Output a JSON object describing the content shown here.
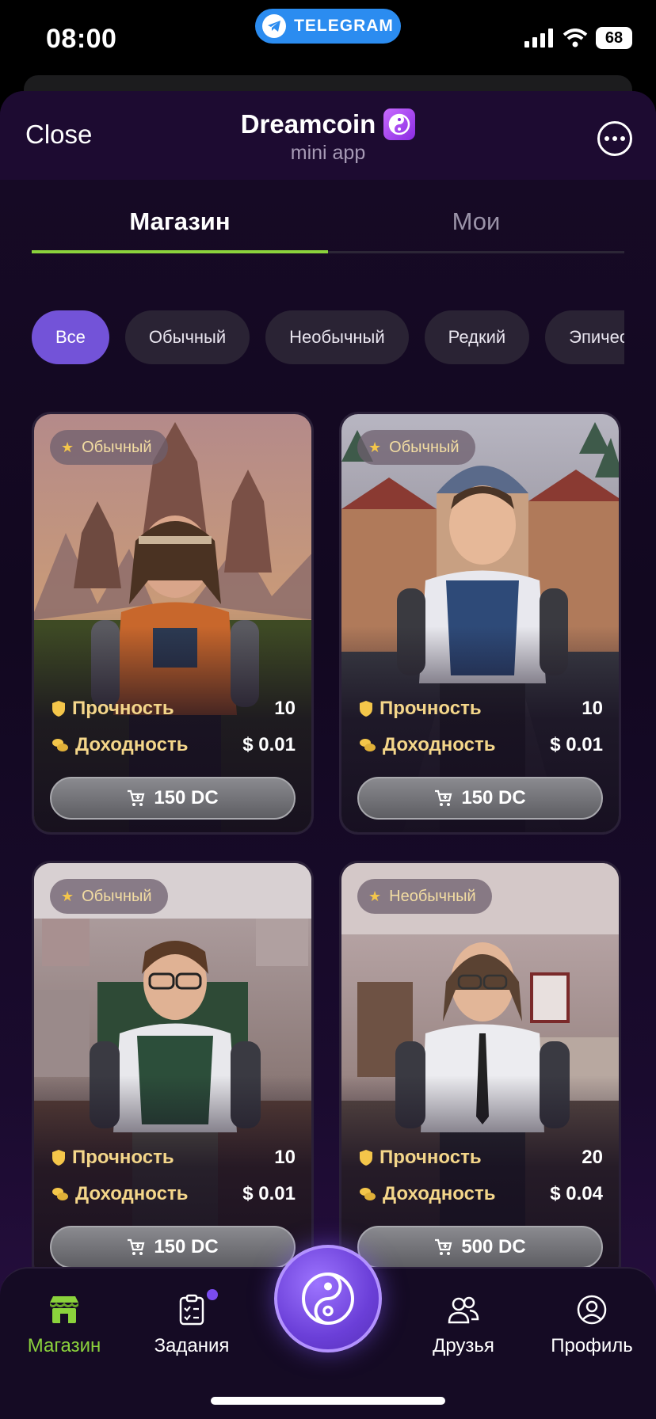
{
  "status_bar": {
    "time": "08:00",
    "telegram_label": "TELEGRAM",
    "battery": "68"
  },
  "header": {
    "close_label": "Close",
    "title": "Dreamcoin",
    "subtitle": "mini app"
  },
  "tabs": [
    {
      "label": "Магазин"
    },
    {
      "label": "Мои"
    }
  ],
  "filters": [
    {
      "label": "Все"
    },
    {
      "label": "Обычный"
    },
    {
      "label": "Необычный"
    },
    {
      "label": "Редкий"
    },
    {
      "label": "Эпичес"
    }
  ],
  "cards": [
    {
      "rarity": "Обычный",
      "durability_label": "Прочность",
      "durability": "10",
      "income_label": "Доходность",
      "income": "$ 0.01",
      "price": "150 DC"
    },
    {
      "rarity": "Обычный",
      "durability_label": "Прочность",
      "durability": "10",
      "income_label": "Доходность",
      "income": "$ 0.01",
      "price": "150 DC"
    },
    {
      "rarity": "Обычный",
      "durability_label": "Прочность",
      "durability": "10",
      "income_label": "Доходность",
      "income": "$ 0.01",
      "price": "150 DC"
    },
    {
      "rarity": "Необычный",
      "durability_label": "Прочность",
      "durability": "20",
      "income_label": "Доходность",
      "income": "$ 0.04",
      "price": "500 DC"
    }
  ],
  "bottom_nav": [
    {
      "label": "Магазин",
      "icon": "store-icon"
    },
    {
      "label": "Задания",
      "icon": "tasks-icon"
    },
    {
      "label": "Друзья",
      "icon": "friends-icon"
    },
    {
      "label": "Профиль",
      "icon": "profile-icon"
    }
  ],
  "colors": {
    "accent_green": "#8bd23c",
    "accent_purple": "#7353d8",
    "gold": "#f4d68a"
  }
}
